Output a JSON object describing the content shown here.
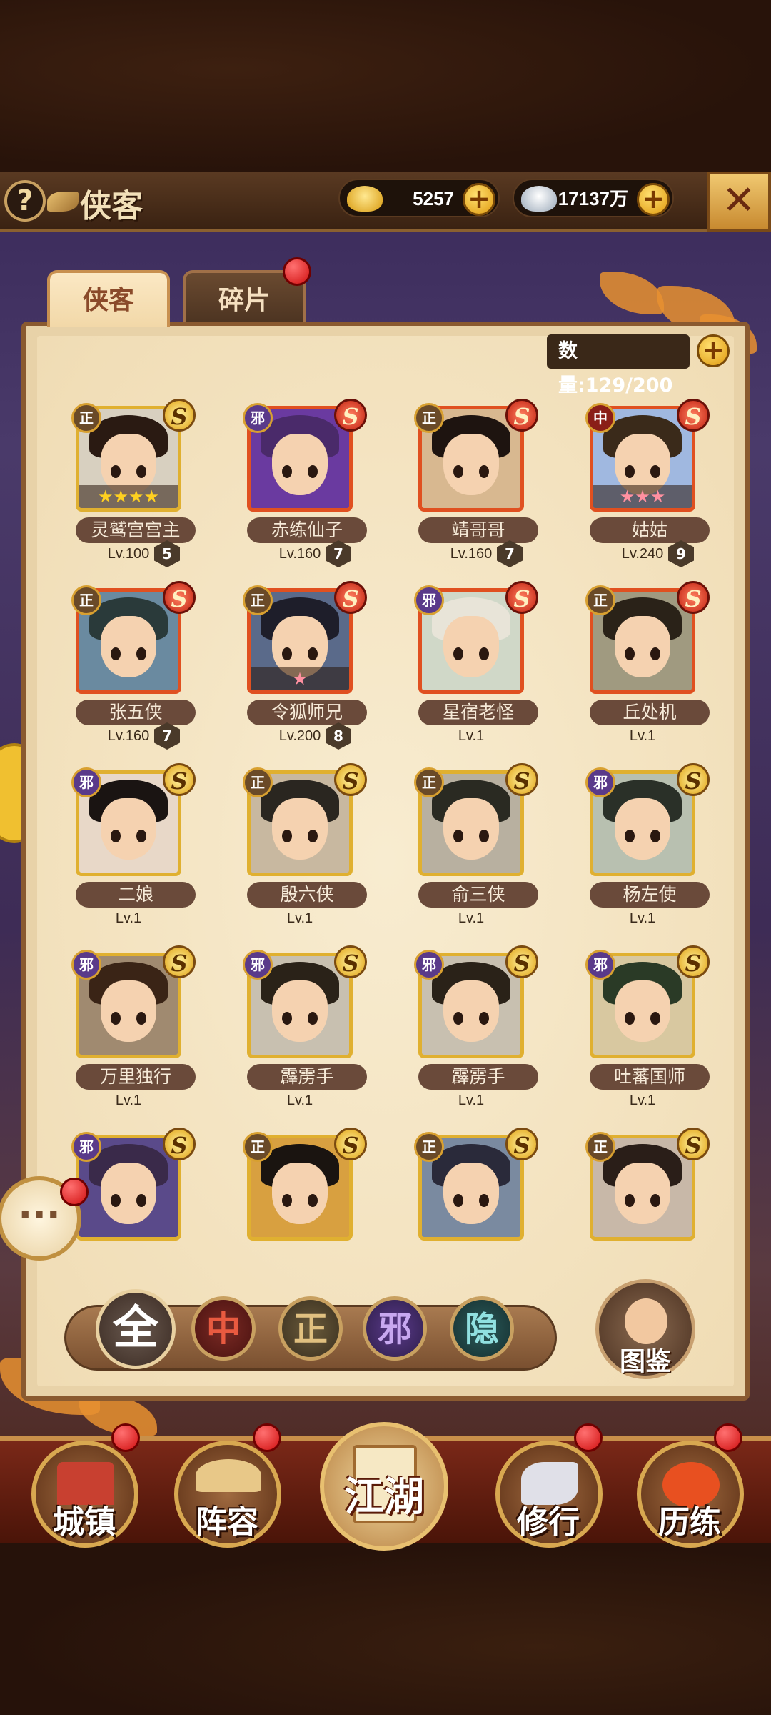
{
  "header": {
    "title": "侠客",
    "help_icon": "?",
    "gold": {
      "icon": "gold-ingot-icon",
      "value": "5257"
    },
    "silver": {
      "icon": "silver-ingot-icon",
      "value": "17137万"
    },
    "close_icon": "close-icon"
  },
  "tabs": [
    {
      "label": "侠客",
      "active": true
    },
    {
      "label": "碎片",
      "active": false,
      "has_notification": true
    }
  ],
  "roster": {
    "count_label": "数量:129/200"
  },
  "heroes": [
    {
      "name": "灵鹫宫宫主",
      "level": "Lv.100",
      "badge": "5",
      "align": "正",
      "grade": "S",
      "stars": 4,
      "rarity": "gold"
    },
    {
      "name": "赤练仙子",
      "level": "Lv.160",
      "badge": "7",
      "align": "邪",
      "grade": "S",
      "stars": 0,
      "rarity": "red"
    },
    {
      "name": "靖哥哥",
      "level": "Lv.160",
      "badge": "7",
      "align": "正",
      "grade": "S",
      "stars": 0,
      "rarity": "red"
    },
    {
      "name": "姑姑",
      "level": "Lv.240",
      "badge": "9",
      "align": "中",
      "grade": "S",
      "stars": 3,
      "rarity": "red"
    },
    {
      "name": "张五侠",
      "level": "Lv.160",
      "badge": "7",
      "align": "正",
      "grade": "S",
      "stars": 0,
      "rarity": "red"
    },
    {
      "name": "令狐师兄",
      "level": "Lv.200",
      "badge": "8",
      "align": "正",
      "grade": "S",
      "stars": 1,
      "rarity": "red"
    },
    {
      "name": "星宿老怪",
      "level": "Lv.1",
      "badge": "",
      "align": "邪",
      "grade": "S",
      "stars": 0,
      "rarity": "red"
    },
    {
      "name": "丘处机",
      "level": "Lv.1",
      "badge": "",
      "align": "正",
      "grade": "S",
      "stars": 0,
      "rarity": "red"
    },
    {
      "name": "二娘",
      "level": "Lv.1",
      "badge": "",
      "align": "邪",
      "grade": "S",
      "stars": 0,
      "rarity": "gold"
    },
    {
      "name": "殷六侠",
      "level": "Lv.1",
      "badge": "",
      "align": "正",
      "grade": "S",
      "stars": 0,
      "rarity": "gold"
    },
    {
      "name": "俞三侠",
      "level": "Lv.1",
      "badge": "",
      "align": "正",
      "grade": "S",
      "stars": 0,
      "rarity": "gold"
    },
    {
      "name": "杨左使",
      "level": "Lv.1",
      "badge": "",
      "align": "邪",
      "grade": "S",
      "stars": 0,
      "rarity": "gold"
    },
    {
      "name": "万里独行",
      "level": "Lv.1",
      "badge": "",
      "align": "邪",
      "grade": "S",
      "stars": 0,
      "rarity": "gold"
    },
    {
      "name": "霹雳手",
      "level": "Lv.1",
      "badge": "",
      "align": "邪",
      "grade": "S",
      "stars": 0,
      "rarity": "gold"
    },
    {
      "name": "霹雳手",
      "level": "Lv.1",
      "badge": "",
      "align": "邪",
      "grade": "S",
      "stars": 0,
      "rarity": "gold"
    },
    {
      "name": "吐蕃国师",
      "level": "Lv.1",
      "badge": "",
      "align": "邪",
      "grade": "S",
      "stars": 0,
      "rarity": "gold"
    },
    {
      "name": "",
      "level": "",
      "badge": "",
      "align": "邪",
      "grade": "S",
      "stars": 0,
      "rarity": "gold"
    },
    {
      "name": "",
      "level": "",
      "badge": "",
      "align": "正",
      "grade": "S",
      "stars": 0,
      "rarity": "gold"
    },
    {
      "name": "",
      "level": "",
      "badge": "",
      "align": "正",
      "grade": "S",
      "stars": 0,
      "rarity": "gold"
    },
    {
      "name": "",
      "level": "",
      "badge": "",
      "align": "正",
      "grade": "S",
      "stars": 0,
      "rarity": "gold"
    }
  ],
  "filters": [
    {
      "key": "all",
      "label": "全",
      "selected": true
    },
    {
      "key": "zhong",
      "label": "中"
    },
    {
      "key": "zheng",
      "label": "正"
    },
    {
      "key": "xie",
      "label": "邪"
    },
    {
      "key": "yin",
      "label": "隐"
    }
  ],
  "codex": {
    "label": "图鉴",
    "icon": "codex-portrait-icon"
  },
  "chat": {
    "icon": "chat-bubble-icon",
    "glyph": "···"
  },
  "nav": [
    {
      "label": "城镇",
      "icon": "town-icon",
      "has_notification": true
    },
    {
      "label": "阵容",
      "icon": "formation-icon",
      "has_notification": true
    },
    {
      "label": "江湖",
      "icon": "scroll-icon",
      "has_notification": false,
      "center": true
    },
    {
      "label": "修行",
      "icon": "training-icon",
      "has_notification": true
    },
    {
      "label": "历练",
      "icon": "trial-icon",
      "has_notification": true
    }
  ],
  "colors": {
    "gold_frame": "#e0b030",
    "red_frame": "#e05020",
    "panel": "#f0dcb4",
    "notification": "#d01010"
  }
}
